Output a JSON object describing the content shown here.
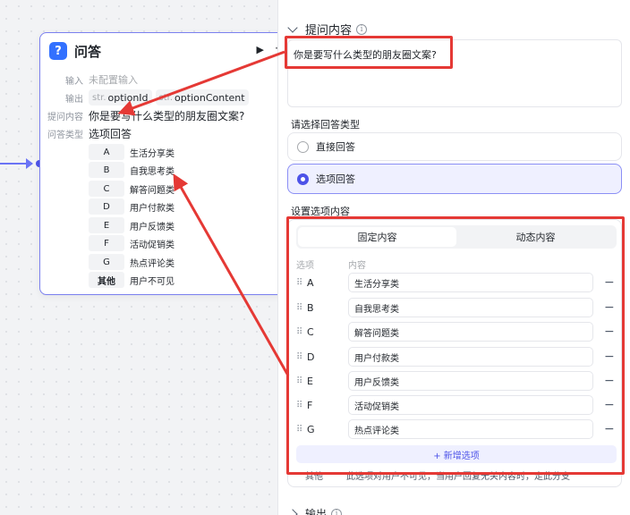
{
  "node": {
    "icon": "?",
    "title": "问答",
    "input_label": "输入",
    "input_value": "未配置输入",
    "output_label": "输出",
    "output_tags": [
      {
        "type": "str.",
        "name": "optionId"
      },
      {
        "type": "str.",
        "name": "optionContent"
      }
    ],
    "question_label": "提问内容",
    "question_value": "你是要写什么类型的朋友圈文案?",
    "answer_type_label": "问答类型",
    "answer_type_value": "选项回答",
    "options": [
      {
        "key": "A",
        "value": "生活分享类"
      },
      {
        "key": "B",
        "value": "自我思考类"
      },
      {
        "key": "C",
        "value": "解答问题类"
      },
      {
        "key": "D",
        "value": "用户付款类"
      },
      {
        "key": "E",
        "value": "用户反馈类"
      },
      {
        "key": "F",
        "value": "活动促销类"
      },
      {
        "key": "G",
        "value": "热点评论类"
      },
      {
        "key": "其他",
        "value": "用户不可见"
      }
    ]
  },
  "panel": {
    "question_section_title": "提问内容",
    "question_text": "你是要写什么类型的朋友圈文案?",
    "answer_type_prompt": "请选择回答类型",
    "answer_types": [
      {
        "label": "直接回答",
        "selected": false
      },
      {
        "label": "选项回答",
        "selected": true
      }
    ],
    "options_section_title": "设置选项内容",
    "tabs": [
      {
        "label": "固定内容",
        "active": true
      },
      {
        "label": "动态内容",
        "active": false
      }
    ],
    "col_option": "选项",
    "col_content": "内容",
    "options": [
      {
        "key": "A",
        "value": "生活分享类"
      },
      {
        "key": "B",
        "value": "自我思考类"
      },
      {
        "key": "C",
        "value": "解答问题类"
      },
      {
        "key": "D",
        "value": "用户付款类"
      },
      {
        "key": "E",
        "value": "用户反馈类"
      },
      {
        "key": "F",
        "value": "活动促销类"
      },
      {
        "key": "G",
        "value": "热点评论类"
      }
    ],
    "add_option_label": "+ 新增选项",
    "other_key": "其他",
    "other_desc": "此选项对用户不可见，当用户回复无关内容时，走此分支",
    "output_section_title": "输出"
  },
  "colors": {
    "accent": "#4d53e8",
    "annotation_red": "#e53935"
  }
}
